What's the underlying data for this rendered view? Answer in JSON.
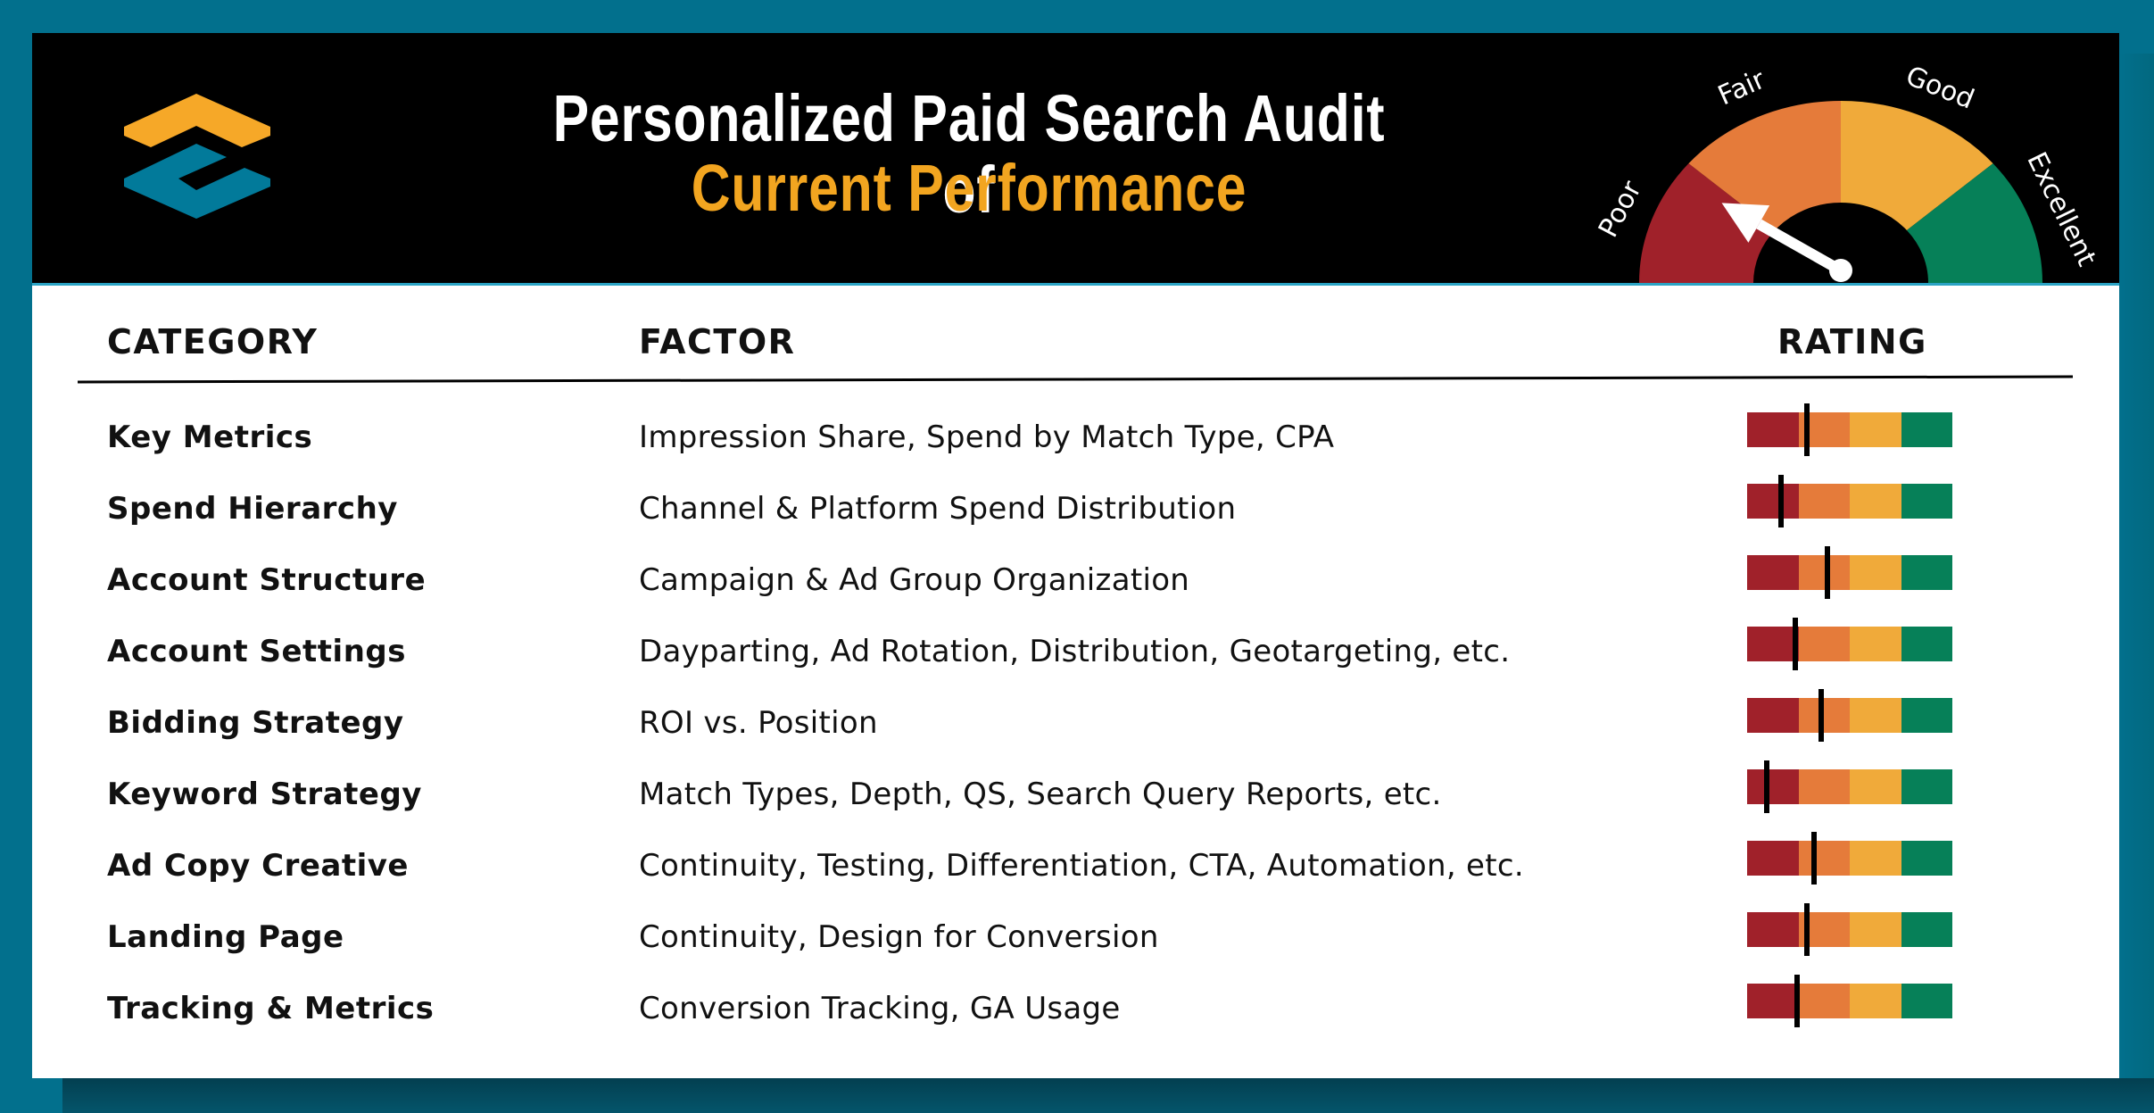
{
  "header": {
    "title_line1": "Personalized Paid Search Audit of",
    "title_line2": "Current Performance",
    "logo_icon": "stacked-chevron-logo-icon"
  },
  "gauge": {
    "labels": [
      "Poor",
      "Fair",
      "Good",
      "Excellent"
    ],
    "needle_level": "Poor",
    "needle_fraction": 0.2
  },
  "colors": {
    "frame": "#02708d",
    "poor": "#a0212a",
    "fair": "#e57b3a",
    "good": "#f0aa3a",
    "excellent": "#068058",
    "title_accent": "#f2a520",
    "logo_orange": "#f6a828",
    "logo_blue": "#027a9a"
  },
  "table": {
    "columns": [
      "CATEGORY",
      "FACTOR",
      "RATING"
    ],
    "rows": [
      {
        "category": "Key Metrics",
        "factor": "Impression Share, Spend by Match Type, CPA",
        "rating": 0.29
      },
      {
        "category": "Spend Hierarchy",
        "factor": "Channel & Platform Spend Distribution",
        "rating": 0.165
      },
      {
        "category": "Account Structure",
        "factor": "Campaign & Ad Group Organization",
        "rating": 0.39
      },
      {
        "category": "Account Settings",
        "factor": "Dayparting, Ad Rotation, Distribution, Geotargeting, etc.",
        "rating": 0.235
      },
      {
        "category": "Bidding Strategy",
        "factor": "ROI vs. Position",
        "rating": 0.36
      },
      {
        "category": "Keyword Strategy",
        "factor": "Match Types, Depth, QS, Search Query Reports, etc.",
        "rating": 0.095
      },
      {
        "category": "Ad Copy Creative",
        "factor": "Continuity, Testing, Differentiation, CTA, Automation, etc.",
        "rating": 0.325
      },
      {
        "category": "Landing Page",
        "factor": "Continuity, Design for Conversion",
        "rating": 0.29
      },
      {
        "category": "Tracking & Metrics",
        "factor": "Conversion Tracking, GA Usage",
        "rating": 0.245
      }
    ]
  }
}
